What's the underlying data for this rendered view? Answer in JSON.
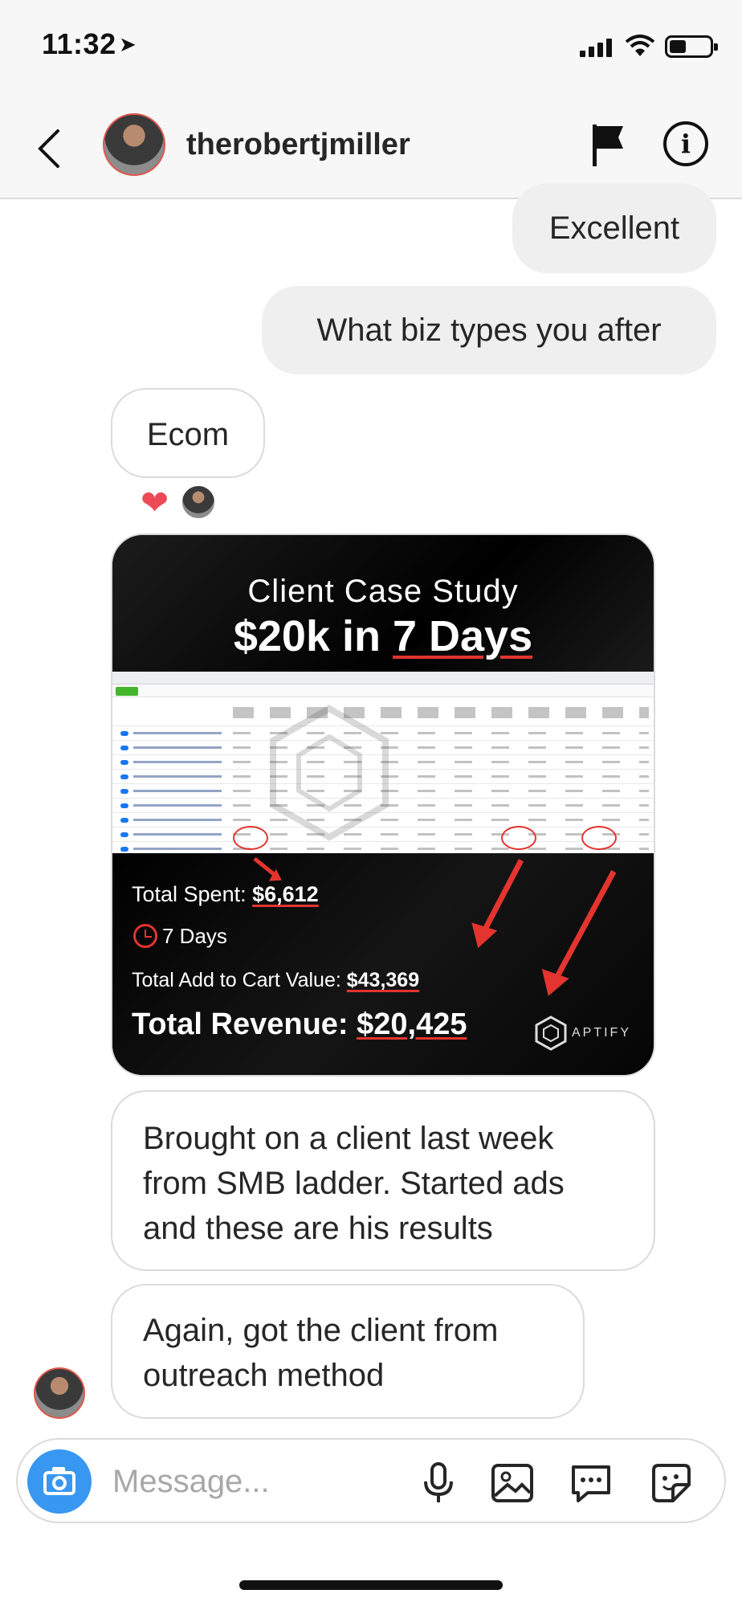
{
  "status_bar": {
    "time": "11:32"
  },
  "header": {
    "username": "therobertjmiller"
  },
  "messages": {
    "excellent": "Excellent",
    "biz_types": "What biz types you after",
    "ecom": "Ecom",
    "brought_on": "Brought on a client last week from SMB ladder. Started ads and these are his results",
    "again": "Again, got the client from outreach method"
  },
  "case_study": {
    "label": "Client Case Study",
    "headline_prefix": "$20k in ",
    "headline_highlight": "7 Days",
    "total_spent_label": "Total Spent: ",
    "total_spent_value": "$6,612",
    "duration": "7 Days",
    "add_to_cart_label": "Total Add to Cart Value: ",
    "add_to_cart_value": "$43,369",
    "revenue_label": "Total Revenue: ",
    "revenue_value": "$20,425",
    "brand": "APTIFY"
  },
  "composer": {
    "placeholder": "Message..."
  },
  "colors": {
    "accent_blue": "#3897f0",
    "heart_red": "#ed4956",
    "annotation_red": "#e3342f"
  },
  "icons": [
    "location-arrow-icon",
    "signal-icon",
    "wifi-icon",
    "battery-icon",
    "back-chevron-icon",
    "flag-icon",
    "info-icon",
    "heart-icon",
    "camera-icon",
    "microphone-icon",
    "image-icon",
    "chat-bubble-icon",
    "sticker-icon"
  ]
}
